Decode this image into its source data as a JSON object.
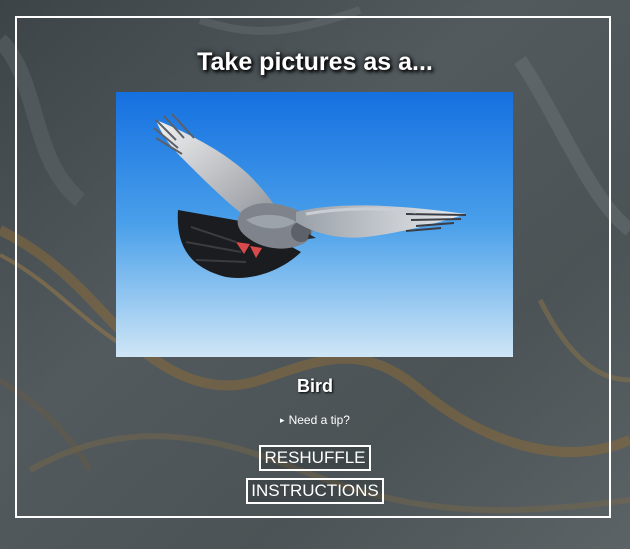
{
  "title": "Take pictures as a...",
  "subject": "Bird",
  "tip_label": "Need a tip?",
  "tip_arrow": "▸",
  "buttons": {
    "reshuffle": "RESHUFFLE",
    "instructions": "INSTRUCTIONS"
  },
  "photo": {
    "subject_icon": "pigeon-in-flight",
    "sky_top": "#1570e0",
    "sky_bottom": "#cfe6f6"
  },
  "colors": {
    "frame": "#ffffff",
    "text": "#ffffff",
    "background": "#4a5257"
  }
}
